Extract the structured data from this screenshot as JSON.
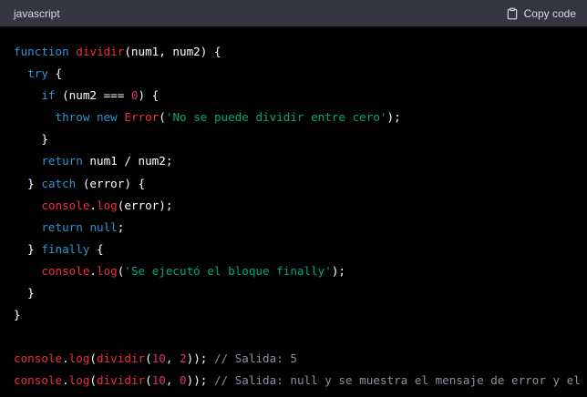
{
  "header": {
    "language": "javascript",
    "copy_label": "Copy code"
  },
  "code_lines": [
    [
      [
        "kw",
        "function"
      ],
      [
        "pl",
        " "
      ],
      [
        "fn",
        "dividir"
      ],
      [
        "pl",
        "(num1, num2) {"
      ]
    ],
    [
      [
        "pl",
        "  "
      ],
      [
        "kw",
        "try"
      ],
      [
        "pl",
        " {"
      ]
    ],
    [
      [
        "pl",
        "    "
      ],
      [
        "kw",
        "if"
      ],
      [
        "pl",
        " (num2 === "
      ],
      [
        "num",
        "0"
      ],
      [
        "pl",
        ") {"
      ]
    ],
    [
      [
        "pl",
        "      "
      ],
      [
        "kw",
        "throw"
      ],
      [
        "pl",
        " "
      ],
      [
        "kw",
        "new"
      ],
      [
        "pl",
        " "
      ],
      [
        "fn",
        "Error"
      ],
      [
        "pl",
        "("
      ],
      [
        "str",
        "'No se puede dividir entre cero'"
      ],
      [
        "pl",
        ");"
      ]
    ],
    [
      [
        "pl",
        "    }"
      ]
    ],
    [
      [
        "pl",
        "    "
      ],
      [
        "kw",
        "return"
      ],
      [
        "pl",
        " num1 / num2;"
      ]
    ],
    [
      [
        "pl",
        "  } "
      ],
      [
        "kw",
        "catch"
      ],
      [
        "pl",
        " (error) {"
      ]
    ],
    [
      [
        "pl",
        "    "
      ],
      [
        "fn",
        "console"
      ],
      [
        "pl",
        "."
      ],
      [
        "fn",
        "log"
      ],
      [
        "pl",
        "(error);"
      ]
    ],
    [
      [
        "pl",
        "    "
      ],
      [
        "kw",
        "return"
      ],
      [
        "pl",
        " "
      ],
      [
        "kw",
        "null"
      ],
      [
        "pl",
        ";"
      ]
    ],
    [
      [
        "pl",
        "  } "
      ],
      [
        "kw",
        "finally"
      ],
      [
        "pl",
        " {"
      ]
    ],
    [
      [
        "pl",
        "    "
      ],
      [
        "fn",
        "console"
      ],
      [
        "pl",
        "."
      ],
      [
        "fn",
        "log"
      ],
      [
        "pl",
        "("
      ],
      [
        "str",
        "'Se ejecutó el bloque finally'"
      ],
      [
        "pl",
        ");"
      ]
    ],
    [
      [
        "pl",
        "  }"
      ]
    ],
    [
      [
        "pl",
        "}"
      ]
    ],
    [
      [
        "pl",
        ""
      ]
    ],
    [
      [
        "fn",
        "console"
      ],
      [
        "pl",
        "."
      ],
      [
        "fn",
        "log"
      ],
      [
        "pl",
        "("
      ],
      [
        "fn",
        "dividir"
      ],
      [
        "pl",
        "("
      ],
      [
        "num",
        "10"
      ],
      [
        "pl",
        ", "
      ],
      [
        "num",
        "2"
      ],
      [
        "pl",
        "));"
      ],
      [
        "cm",
        " // Salida: 5"
      ]
    ],
    [
      [
        "fn",
        "console"
      ],
      [
        "pl",
        "."
      ],
      [
        "fn",
        "log"
      ],
      [
        "pl",
        "("
      ],
      [
        "fn",
        "dividir"
      ],
      [
        "pl",
        "("
      ],
      [
        "num",
        "10"
      ],
      [
        "pl",
        ", "
      ],
      [
        "num",
        "0"
      ],
      [
        "pl",
        "));"
      ],
      [
        "cm",
        " // Salida: null y se muestra el mensaje de error y el"
      ]
    ]
  ],
  "colors": {
    "keyword": "#2e95d3",
    "function": "#f22c3d",
    "string": "#00a67d",
    "number": "#df3079",
    "comment": "#8e8ea0",
    "plain": "#ffffff",
    "header_bg": "#343541",
    "code_bg": "#000000"
  },
  "icons": {
    "copy": "clipboard-icon"
  }
}
